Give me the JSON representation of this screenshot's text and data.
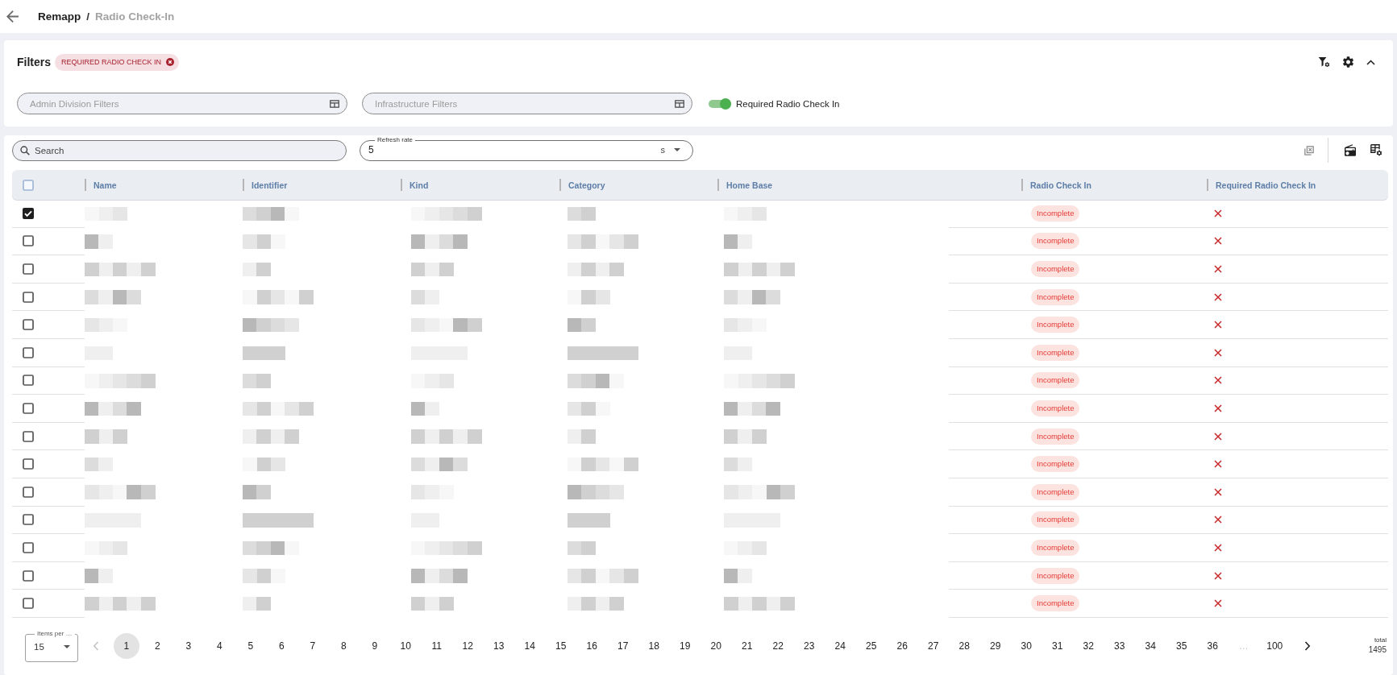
{
  "header": {
    "breadcrumb": [
      {
        "label": "Remapp",
        "current": false
      },
      {
        "label": "Radio Check-In",
        "current": true
      }
    ],
    "separator": "/"
  },
  "filters": {
    "title": "Filters",
    "expanded": true,
    "chips": [
      {
        "label": "REQUIRED RADIO CHECK IN"
      }
    ],
    "fields": [
      {
        "placeholder": "Admin Division Filters"
      },
      {
        "placeholder": "Infrastructure Filters"
      }
    ],
    "toggle": {
      "label": "Required Radio Check In",
      "on": true
    }
  },
  "toolbar": {
    "search": {
      "placeholder": "Search"
    },
    "refresh_rate": {
      "label": "Refresh rate",
      "value": "5",
      "unit": "s"
    }
  },
  "table": {
    "select_all_checked": false,
    "columns": [
      "Name",
      "Identifier",
      "Kind",
      "Category",
      "Home Base",
      "Radio Check In",
      "Required Radio Check In"
    ],
    "rows": [
      {
        "selected": true,
        "radio_check_in": "Incomplete",
        "required_radio_check_in": false
      },
      {
        "selected": false,
        "radio_check_in": "Incomplete",
        "required_radio_check_in": false
      },
      {
        "selected": false,
        "radio_check_in": "Incomplete",
        "required_radio_check_in": false
      },
      {
        "selected": false,
        "radio_check_in": "Incomplete",
        "required_radio_check_in": false
      },
      {
        "selected": false,
        "radio_check_in": "Incomplete",
        "required_radio_check_in": false
      },
      {
        "selected": false,
        "radio_check_in": "Incomplete",
        "required_radio_check_in": false
      },
      {
        "selected": false,
        "radio_check_in": "Incomplete",
        "required_radio_check_in": false
      },
      {
        "selected": false,
        "radio_check_in": "Incomplete",
        "required_radio_check_in": false
      },
      {
        "selected": false,
        "radio_check_in": "Incomplete",
        "required_radio_check_in": false
      },
      {
        "selected": false,
        "radio_check_in": "Incomplete",
        "required_radio_check_in": false
      },
      {
        "selected": false,
        "radio_check_in": "Incomplete",
        "required_radio_check_in": false
      },
      {
        "selected": false,
        "radio_check_in": "Incomplete",
        "required_radio_check_in": false
      },
      {
        "selected": false,
        "radio_check_in": "Incomplete",
        "required_radio_check_in": false
      },
      {
        "selected": false,
        "radio_check_in": "Incomplete",
        "required_radio_check_in": false
      },
      {
        "selected": false,
        "radio_check_in": "Incomplete",
        "required_radio_check_in": false
      }
    ]
  },
  "pagination": {
    "items_per_page": {
      "label": "Items per …",
      "value": "15"
    },
    "prev_disabled": true,
    "next_disabled": false,
    "pages": [
      {
        "kind": "page",
        "label": "1",
        "selected": true
      },
      {
        "kind": "page",
        "label": "2",
        "selected": false
      },
      {
        "kind": "page",
        "label": "3",
        "selected": false
      },
      {
        "kind": "page",
        "label": "4",
        "selected": false
      },
      {
        "kind": "page",
        "label": "5",
        "selected": false
      },
      {
        "kind": "page",
        "label": "6",
        "selected": false
      },
      {
        "kind": "page",
        "label": "7",
        "selected": false
      },
      {
        "kind": "page",
        "label": "8",
        "selected": false
      },
      {
        "kind": "page",
        "label": "9",
        "selected": false
      },
      {
        "kind": "page",
        "label": "10",
        "selected": false
      },
      {
        "kind": "page",
        "label": "11",
        "selected": false
      },
      {
        "kind": "page",
        "label": "12",
        "selected": false
      },
      {
        "kind": "page",
        "label": "13",
        "selected": false
      },
      {
        "kind": "page",
        "label": "14",
        "selected": false
      },
      {
        "kind": "page",
        "label": "15",
        "selected": false
      },
      {
        "kind": "page",
        "label": "16",
        "selected": false
      },
      {
        "kind": "page",
        "label": "17",
        "selected": false
      },
      {
        "kind": "page",
        "label": "18",
        "selected": false
      },
      {
        "kind": "page",
        "label": "19",
        "selected": false
      },
      {
        "kind": "page",
        "label": "20",
        "selected": false
      },
      {
        "kind": "page",
        "label": "21",
        "selected": false
      },
      {
        "kind": "page",
        "label": "22",
        "selected": false
      },
      {
        "kind": "page",
        "label": "23",
        "selected": false
      },
      {
        "kind": "page",
        "label": "24",
        "selected": false
      },
      {
        "kind": "page",
        "label": "25",
        "selected": false
      },
      {
        "kind": "page",
        "label": "26",
        "selected": false
      },
      {
        "kind": "page",
        "label": "27",
        "selected": false
      },
      {
        "kind": "page",
        "label": "28",
        "selected": false
      },
      {
        "kind": "page",
        "label": "29",
        "selected": false
      },
      {
        "kind": "page",
        "label": "30",
        "selected": false
      },
      {
        "kind": "page",
        "label": "31",
        "selected": false
      },
      {
        "kind": "page",
        "label": "32",
        "selected": false
      },
      {
        "kind": "page",
        "label": "33",
        "selected": false
      },
      {
        "kind": "page",
        "label": "34",
        "selected": false
      },
      {
        "kind": "page",
        "label": "35",
        "selected": false
      },
      {
        "kind": "page",
        "label": "36",
        "selected": false
      },
      {
        "kind": "ellipsis",
        "label": "…"
      },
      {
        "kind": "page",
        "label": "100",
        "selected": false
      }
    ],
    "total_label": "total",
    "total": "1495"
  }
}
